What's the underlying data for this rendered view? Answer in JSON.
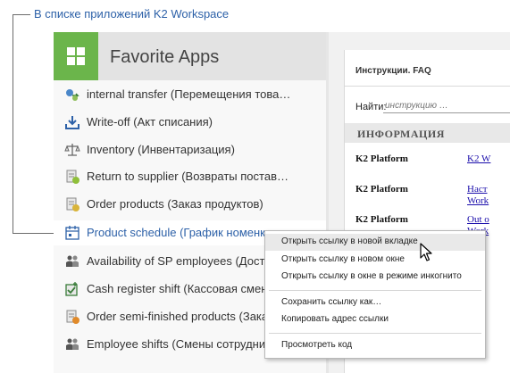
{
  "callout": {
    "text": "В списке приложений K2 Workspace"
  },
  "favorites": {
    "title": "Favorite Apps",
    "items": [
      {
        "label": "internal transfer (Перемещения това…",
        "icon": "transfer-icon"
      },
      {
        "label": "Write-off (Акт списания)",
        "icon": "download-icon"
      },
      {
        "label": "Inventory (Инвентаризация)",
        "icon": "scales-icon"
      },
      {
        "label": "Return to supplier (Возвраты постав…",
        "icon": "document-check-icon"
      },
      {
        "label": "Order products (Заказ продуктов)",
        "icon": "document-check-icon"
      },
      {
        "label": "Product schedule (График номенкл",
        "icon": "calendar-icon"
      },
      {
        "label": "Availability of SP employees (Доступ",
        "icon": "people-icon"
      },
      {
        "label": "Cash register shift (Кассовая смена",
        "icon": "register-icon"
      },
      {
        "label": "Order semi-finished products (Зака",
        "icon": "document-gear-icon"
      },
      {
        "label": "Employee shifts (Смены сотрудник",
        "icon": "people-icon"
      }
    ]
  },
  "context_menu": {
    "items": [
      "Открыть ссылку в новой вкладке",
      "Открыть ссылку в новом окне",
      "Открыть ссылку в окне в режиме инкогнито",
      "Сохранить ссылку как…",
      "Копировать адрес ссылки",
      "Просмотреть код"
    ]
  },
  "faq": {
    "title": "Инструкции. FAQ",
    "find_label": "Найти:",
    "find_placeholder": "инструкцию …",
    "section": "ИНФОРМАЦИЯ",
    "rows": [
      {
        "name": "K2 Platform",
        "link": "K2 W"
      },
      {
        "name": "K2 Platform",
        "link": "Наст\nWork"
      },
      {
        "name": "K2 Platform",
        "link": "Out o\nWork"
      }
    ]
  },
  "colors": {
    "accent": "#2d61a8",
    "logo_green": "#6bb54b"
  }
}
